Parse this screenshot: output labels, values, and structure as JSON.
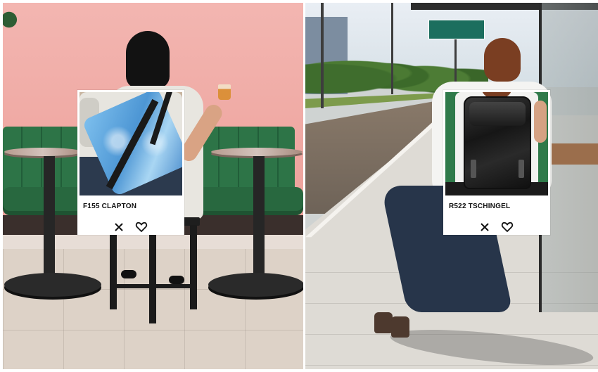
{
  "products": [
    {
      "name": "F155 CLAPTON",
      "close_icon": "close-icon",
      "favorite_icon": "heart-icon"
    },
    {
      "name": "R522 TSCHINGEL",
      "close_icon": "close-icon",
      "favorite_icon": "heart-icon"
    }
  ],
  "colors": {
    "wall_pink": "#f3b6b1",
    "bench_green": "#2f7a4a",
    "card_bg": "#ffffff",
    "text": "#111111",
    "bag_blue": "#4d96d4",
    "bag_black": "#161616"
  }
}
